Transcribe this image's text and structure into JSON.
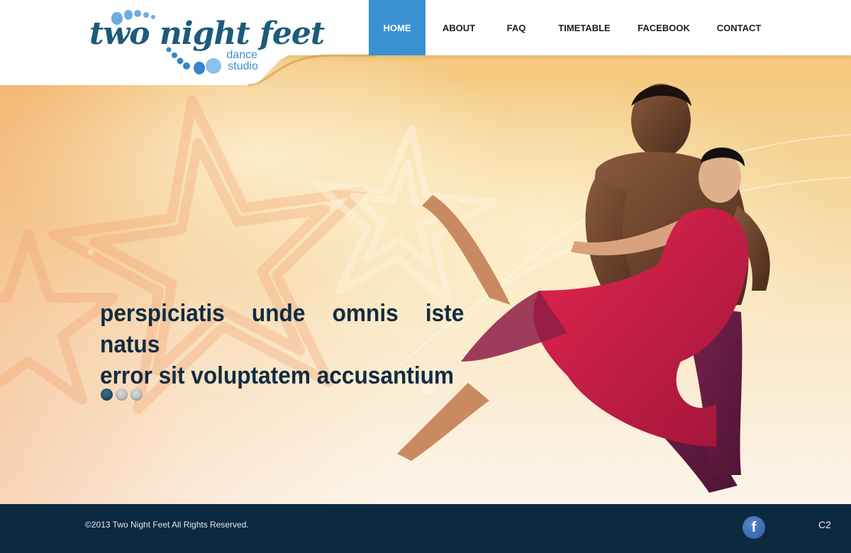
{
  "header": {
    "logo": {
      "wordmark": "two night feet",
      "sub_line1": "dance",
      "sub_line2": "studio"
    },
    "nav": {
      "items": [
        {
          "label": "HOME",
          "active": true
        },
        {
          "label": "ABOUT",
          "active": false
        },
        {
          "label": "FAQ",
          "active": false
        },
        {
          "label": "TIMETABLE",
          "active": false
        },
        {
          "label": "FACEBOOK",
          "active": false
        },
        {
          "label": "CONTACT",
          "active": false
        }
      ]
    }
  },
  "hero": {
    "headline_line1": "perspiciatis unde omnis iste natus",
    "headline_line2": "error sit voluptatem accusantium",
    "slider": {
      "count": 3,
      "active_index": 0
    }
  },
  "footer": {
    "copyright": "©2013 Two Night Feet All Rights Reserved.",
    "social_icon": "facebook-icon",
    "social_glyph": "f",
    "page_code": "C2"
  },
  "colors": {
    "accent_blue": "#3990d3",
    "logo_dark_blue": "#1c5b79",
    "headline": "#102c42",
    "footer_bg": "#0b2a3f"
  }
}
